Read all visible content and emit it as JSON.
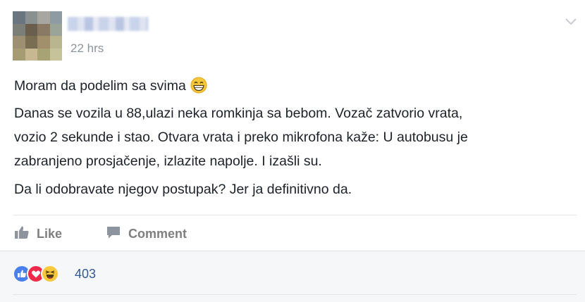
{
  "post": {
    "time": "22 hrs",
    "line1": "Moram da podelim sa svima",
    "paragraph2": [
      "Danas se vozila u 88,ulazi neka romkinja sa bebom. Vozač zatvorio vrata,",
      "vozio 2 sekunde i stao. Otvara vrata i preko mikrofona kaže: U autobusu je",
      "zabranjeno prosjačenje, izlazite napolje. I izašli su."
    ],
    "paragraph3": "Da li odobravate njegov postupak? Jer ja definitivno da."
  },
  "actions": {
    "like_label": "Like",
    "comment_label": "Comment"
  },
  "reactions": {
    "icons": [
      "like-reaction-icon",
      "love-reaction-icon",
      "haha-reaction-icon"
    ],
    "count": "403",
    "colors": {
      "like": "#4a7ff0",
      "love": "#f0284a",
      "haha": "#f7c839",
      "link": "#365899"
    }
  }
}
